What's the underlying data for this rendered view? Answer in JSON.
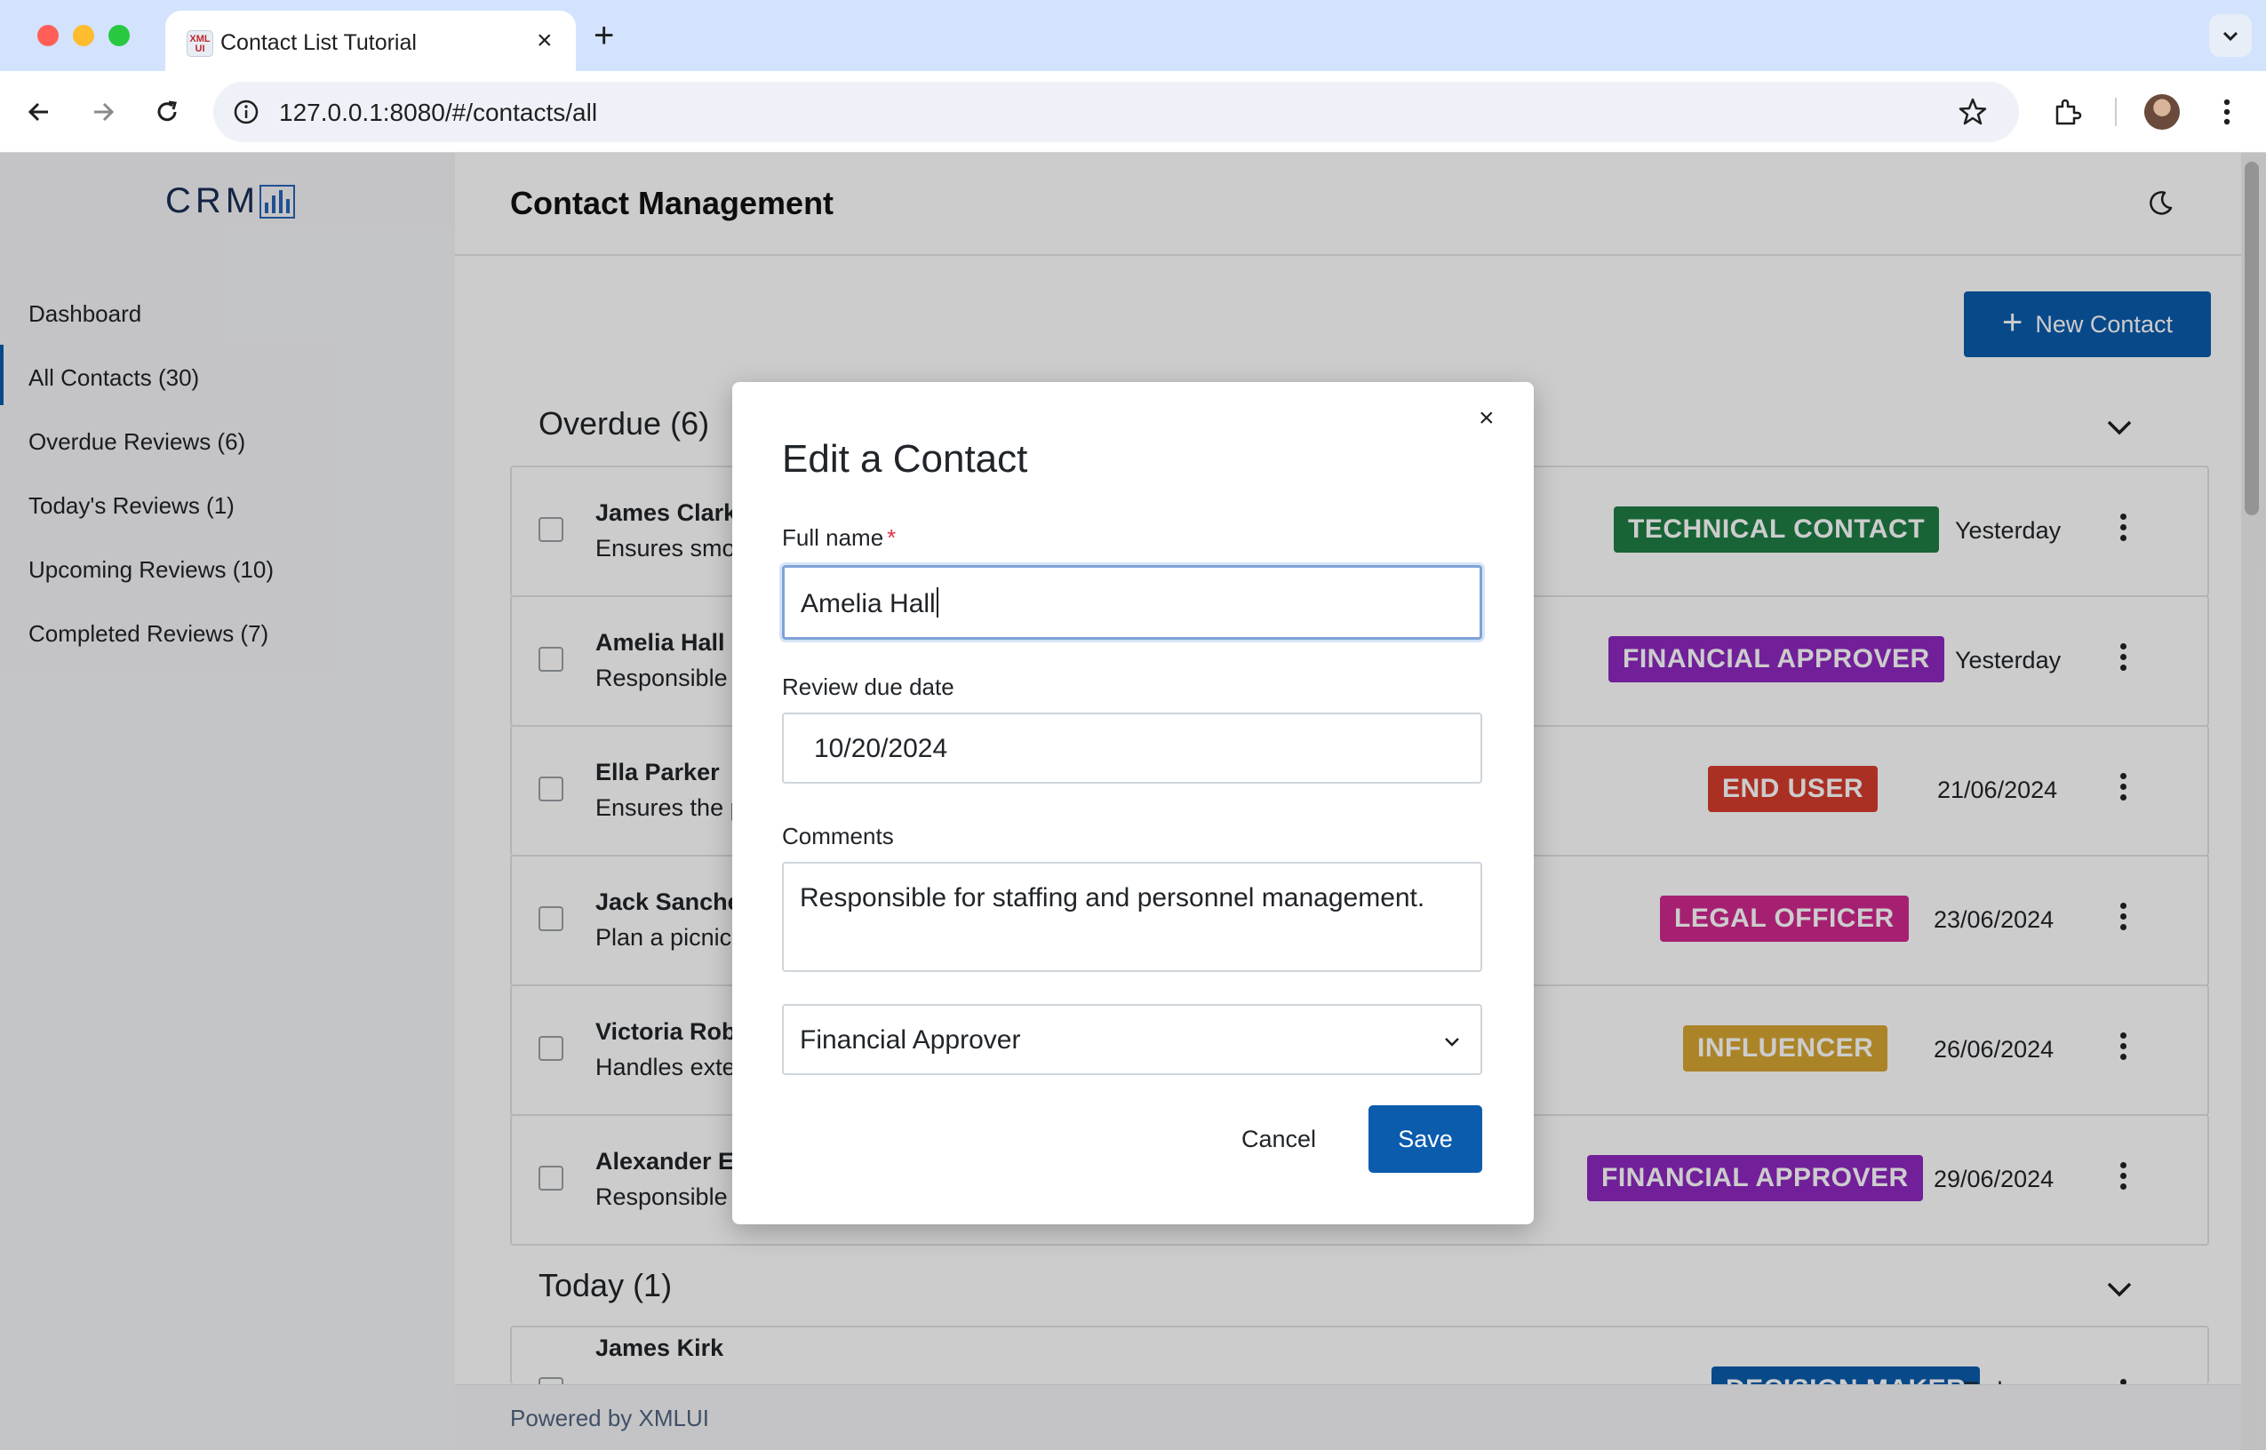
{
  "browser": {
    "tab_title": "Contact List Tutorial",
    "favicon_text": "XML UI",
    "url": "127.0.0.1:8080/#/contacts/all"
  },
  "sidebar": {
    "logo_text": "CRM",
    "items": [
      {
        "label": "Dashboard"
      },
      {
        "label": "All Contacts (30)",
        "active": true
      },
      {
        "label": "Overdue Reviews (6)"
      },
      {
        "label": "Today's Reviews (1)"
      },
      {
        "label": "Upcoming Reviews (10)"
      },
      {
        "label": "Completed Reviews (7)"
      }
    ]
  },
  "header": {
    "title": "Contact Management",
    "theme_icon": "moon-icon"
  },
  "new_contact_label": "New Contact",
  "sections": {
    "overdue_title": "Overdue (6)",
    "today_title": "Today (1)"
  },
  "contacts": [
    {
      "name": "James Clark",
      "desc": "Ensures smo",
      "badge": "TECHNICAL CONTACT",
      "badge_color": "#1e7d45",
      "date": "Yesterday"
    },
    {
      "name": "Amelia Hall",
      "desc": "Responsible",
      "badge": "FINANCIAL APPROVER",
      "badge_color": "#8e29c0",
      "date": "Yesterday"
    },
    {
      "name": "Ella Parker",
      "desc": "Ensures the p",
      "badge": "END USER",
      "badge_color": "#d63d2e",
      "date": "21/06/2024"
    },
    {
      "name": "Jack Sanche",
      "desc": "Plan a picnic",
      "badge": "LEGAL OFFICER",
      "badge_color": "#d0288f",
      "date": "23/06/2024"
    },
    {
      "name": "Victoria Rob",
      "desc": "Handles exte",
      "badge": "INFLUENCER",
      "badge_color": "#d8a632",
      "date": "26/06/2024"
    },
    {
      "name": "Alexander Ev",
      "desc": "Responsible",
      "badge": "FINANCIAL APPROVER",
      "badge_color": "#8e29c0",
      "date": "29/06/2024"
    }
  ],
  "today_contacts": [
    {
      "name": "James Kirk",
      "desc": "",
      "badge": "DECISION MAKER",
      "badge_color": "#0b5cad",
      "date": "Today"
    }
  ],
  "footer": {
    "text": "Powered by XMLUI"
  },
  "modal": {
    "title": "Edit a Contact",
    "close_icon": "close-icon",
    "full_name_label": "Full name",
    "required_marker": "*",
    "full_name_value": "Amelia Hall",
    "review_date_label": "Review due date",
    "review_date_value": "10/20/2024",
    "comments_label": "Comments",
    "comments_value": "Responsible for staffing and personnel management.",
    "category_value": "Financial Approver",
    "cancel_label": "Cancel",
    "save_label": "Save"
  }
}
